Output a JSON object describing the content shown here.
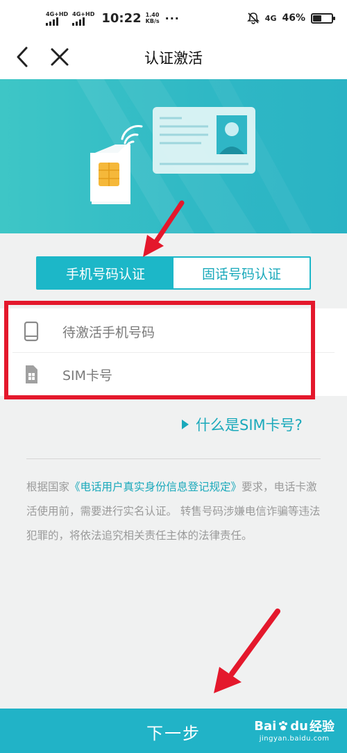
{
  "status_bar": {
    "signal_1": "4G+HD",
    "signal_2": "4G+HD",
    "time": "10:22",
    "speed_value": "1.40",
    "speed_unit": "KB/s",
    "more": "···",
    "network": "4G",
    "battery": "46%",
    "battery_level": 0.46
  },
  "nav": {
    "title": "认证激活",
    "back_icon": "back-arrow-icon",
    "close_icon": "close-icon"
  },
  "tabs": [
    {
      "label": "手机号码认证",
      "active": true
    },
    {
      "label": "固话号码认证",
      "active": false
    }
  ],
  "form": {
    "phone_placeholder": "待激活手机号码",
    "sim_placeholder": "SIM卡号",
    "phone_icon": "phone-icon",
    "sim_icon": "sim-card-icon"
  },
  "sim_help_link": "什么是SIM卡号?",
  "notice": {
    "prefix": "根据国家",
    "highlight": "《电话用户真实身份信息登记规定》",
    "suffix": "要求，电话卡激活使用前，需要进行实名认证。 转售号码涉嫌电信诈骗等违法犯罪的，将依法追究相关责任主体的法律责任。"
  },
  "footer": {
    "next_label": "下一步",
    "watermark_brand_a": "Bai",
    "watermark_brand_b": "du",
    "watermark_word": "经验",
    "watermark_url": "jingyan.baidu.com"
  },
  "colors": {
    "accent": "#1cb7c8",
    "highlight_box": "#e4182c",
    "footer": "#21b3c7"
  }
}
